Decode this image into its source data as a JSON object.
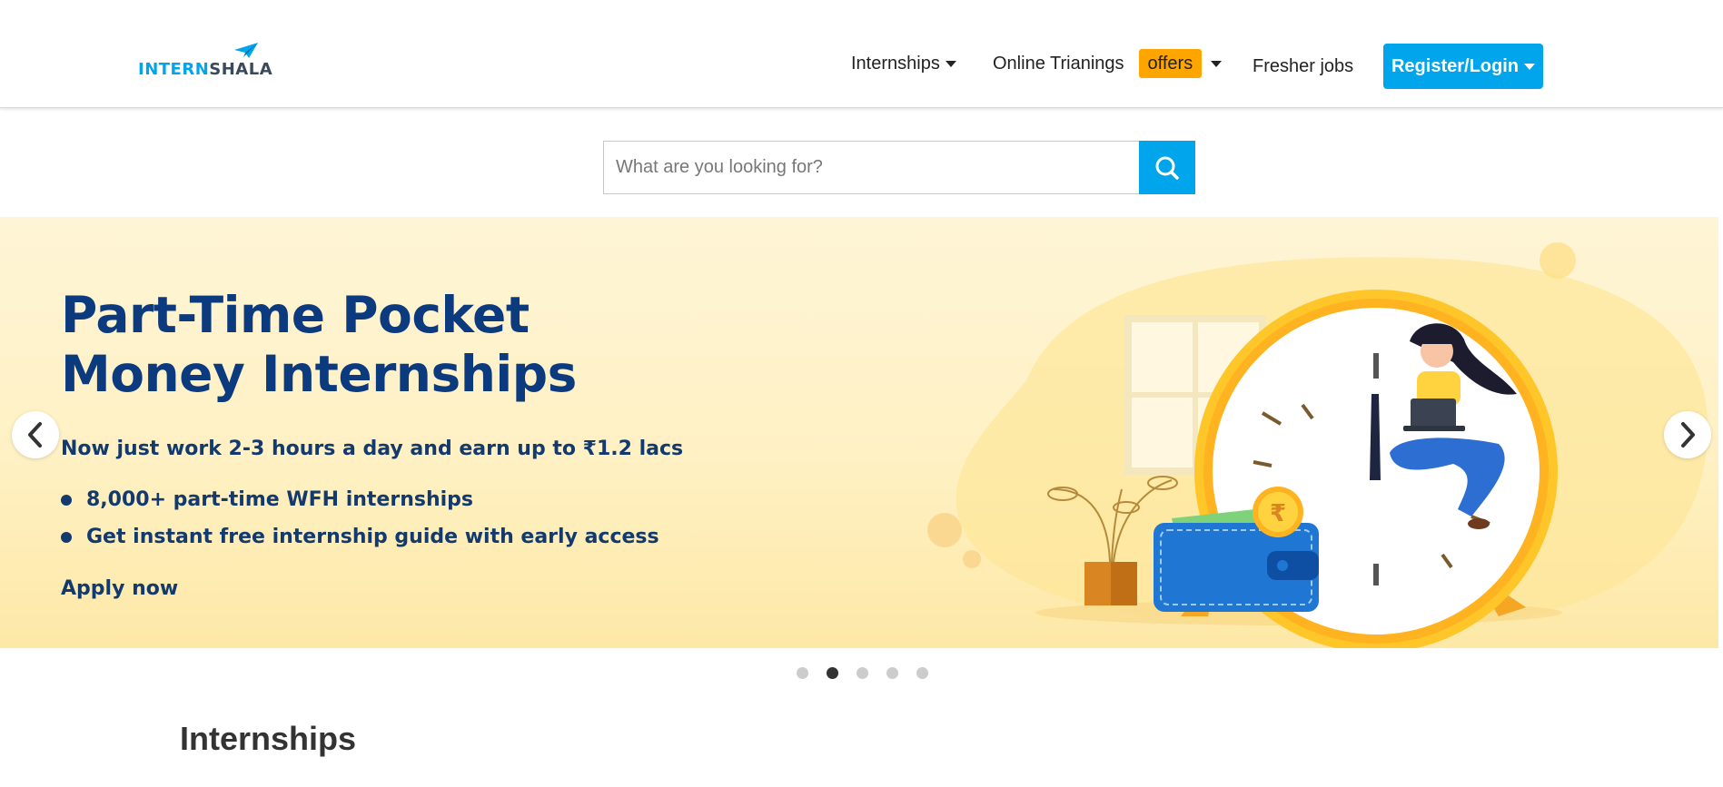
{
  "header": {
    "logo": {
      "part1": "INTERN",
      "part2": "SHALA"
    },
    "nav": {
      "internships": "Internships",
      "online_trainings": "Online Trianings",
      "offers_badge": "offers",
      "fresher_jobs": "Fresher jobs",
      "register": "Register/Login"
    }
  },
  "search": {
    "placeholder": "What are you looking for?",
    "icon": "search-icon"
  },
  "banner": {
    "title_line1": "Part-Time Pocket",
    "title_line2": "Money Internships",
    "subtitle": "Now just work 2-3 hours a day and earn up to ₹1.2 lacs",
    "bullets": [
      "8,000+ part-time WFH internships",
      "Get instant free internship guide with early access"
    ],
    "cta": "Apply now",
    "coin_symbol": "₹"
  },
  "carousel": {
    "slide_count": 5,
    "active_index": 1,
    "prev_icon": "chevron-left-icon",
    "next_icon": "chevron-right-icon"
  },
  "section": {
    "title": "Internships"
  },
  "colors": {
    "brand_blue": "#00a5ec",
    "offers_orange": "#ffa500",
    "banner_navy": "#0b3a7e"
  }
}
